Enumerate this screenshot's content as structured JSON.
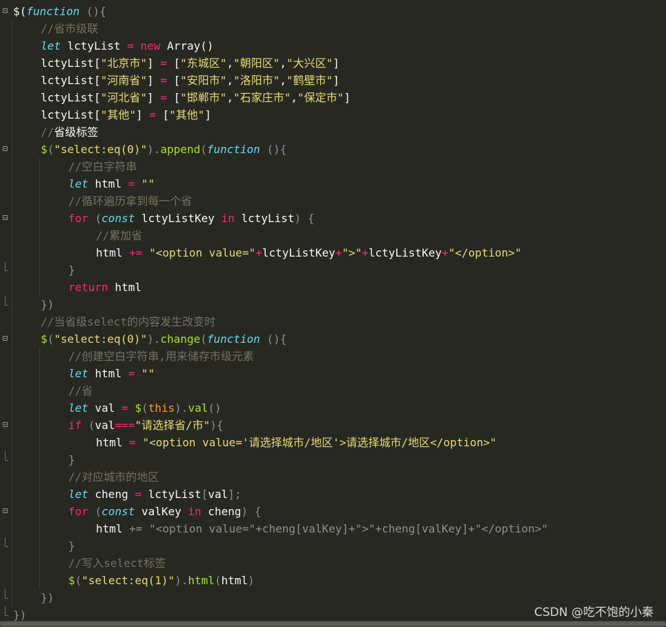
{
  "editor": {
    "lines": [
      {
        "indent": 0,
        "fold": "open",
        "tokens": [
          [
            "p",
            "$("
          ],
          [
            "i",
            "function"
          ],
          [
            "d",
            " (){"
          ]
        ]
      },
      {
        "indent": 1,
        "tokens": [
          [
            "c",
            "//省市级联"
          ]
        ]
      },
      {
        "indent": 1,
        "tokens": [
          [
            "i",
            "let"
          ],
          [
            "p",
            " lctyList "
          ],
          [
            "k",
            "="
          ],
          [
            "p",
            " "
          ],
          [
            "k",
            "new"
          ],
          [
            "p",
            " Array()"
          ]
        ]
      },
      {
        "indent": 1,
        "tokens": [
          [
            "p",
            "lctyList["
          ],
          [
            "s",
            "\"北京市\""
          ],
          [
            "p",
            "] "
          ],
          [
            "k",
            "="
          ],
          [
            "p",
            " ["
          ],
          [
            "s",
            "\"东城区\""
          ],
          [
            "p",
            ","
          ],
          [
            "s",
            "\"朝阳区\""
          ],
          [
            "p",
            ","
          ],
          [
            "s",
            "\"大兴区\""
          ],
          [
            "p",
            "]"
          ]
        ]
      },
      {
        "indent": 1,
        "tokens": [
          [
            "p",
            "lctyList["
          ],
          [
            "s",
            "\"河南省\""
          ],
          [
            "p",
            "] "
          ],
          [
            "k",
            "="
          ],
          [
            "p",
            " ["
          ],
          [
            "s",
            "\"安阳市\""
          ],
          [
            "p",
            ","
          ],
          [
            "s",
            "\"洛阳市\""
          ],
          [
            "p",
            ","
          ],
          [
            "s",
            "\"鹤壁市\""
          ],
          [
            "p",
            "]"
          ]
        ]
      },
      {
        "indent": 1,
        "tokens": [
          [
            "p",
            "lctyList["
          ],
          [
            "s",
            "\"河北省\""
          ],
          [
            "p",
            "] "
          ],
          [
            "k",
            "="
          ],
          [
            "p",
            " ["
          ],
          [
            "s",
            "\"邯郸市\""
          ],
          [
            "p",
            ","
          ],
          [
            "s",
            "\"石家庄市\""
          ],
          [
            "p",
            ","
          ],
          [
            "s",
            "\"保定市\""
          ],
          [
            "p",
            "]"
          ]
        ]
      },
      {
        "indent": 1,
        "tokens": [
          [
            "p",
            "lctyList["
          ],
          [
            "s",
            "\"其他\""
          ],
          [
            "p",
            "] "
          ],
          [
            "k",
            "="
          ],
          [
            "p",
            " ["
          ],
          [
            "s",
            "\"其他\""
          ],
          [
            "p",
            "]"
          ]
        ]
      },
      {
        "indent": 1,
        "tokens": [
          [
            "c",
            "//"
          ],
          [
            "p",
            "省级标签"
          ]
        ]
      },
      {
        "indent": 1,
        "fold": "open",
        "tokens": [
          [
            "f",
            "$"
          ],
          [
            "d",
            "("
          ],
          [
            "s",
            "\"select:eq(0)\""
          ],
          [
            "d",
            ")."
          ],
          [
            "f",
            "append"
          ],
          [
            "d",
            "("
          ],
          [
            "i",
            "function"
          ],
          [
            "d",
            " (){"
          ]
        ]
      },
      {
        "indent": 2,
        "tokens": [
          [
            "c",
            "//空白字符串"
          ]
        ]
      },
      {
        "indent": 2,
        "tokens": [
          [
            "i",
            "let"
          ],
          [
            "p",
            " html "
          ],
          [
            "k",
            "="
          ],
          [
            "p",
            " "
          ],
          [
            "s",
            "\"\""
          ]
        ]
      },
      {
        "indent": 2,
        "tokens": [
          [
            "c",
            "//循环遍历拿到每一个省"
          ]
        ]
      },
      {
        "indent": 2,
        "fold": "open",
        "tokens": [
          [
            "k",
            "for"
          ],
          [
            "d",
            " ("
          ],
          [
            "i",
            "const"
          ],
          [
            "p",
            " lctyListKey "
          ],
          [
            "k",
            "in"
          ],
          [
            "p",
            " lctyList"
          ],
          [
            "d",
            ") {"
          ]
        ]
      },
      {
        "indent": 3,
        "tokens": [
          [
            "c",
            "//累加省"
          ]
        ]
      },
      {
        "indent": 3,
        "tokens": [
          [
            "p",
            "html "
          ],
          [
            "k",
            "+="
          ],
          [
            "p",
            " "
          ],
          [
            "s",
            "\"<option value=\""
          ],
          [
            "k",
            "+"
          ],
          [
            "p",
            "lctyListKey"
          ],
          [
            "k",
            "+"
          ],
          [
            "s",
            "\">\""
          ],
          [
            "k",
            "+"
          ],
          [
            "p",
            "lctyListKey"
          ],
          [
            "k",
            "+"
          ],
          [
            "s",
            "\"</option>\""
          ]
        ]
      },
      {
        "indent": 2,
        "foldend": true,
        "tokens": [
          [
            "d",
            "}"
          ]
        ]
      },
      {
        "indent": 2,
        "tokens": [
          [
            "k",
            "return"
          ],
          [
            "p",
            " html"
          ]
        ]
      },
      {
        "indent": 1,
        "foldend": true,
        "tokens": [
          [
            "d",
            "})"
          ]
        ]
      },
      {
        "indent": 1,
        "tokens": [
          [
            "c",
            "//当省级select的内容发生改变时"
          ]
        ]
      },
      {
        "indent": 1,
        "fold": "open",
        "tokens": [
          [
            "f",
            "$"
          ],
          [
            "d",
            "("
          ],
          [
            "s",
            "\"select:eq(0)\""
          ],
          [
            "d",
            ")."
          ],
          [
            "f",
            "change"
          ],
          [
            "d",
            "("
          ],
          [
            "i",
            "function"
          ],
          [
            "d",
            " (){"
          ]
        ]
      },
      {
        "indent": 2,
        "tokens": [
          [
            "c",
            "//创建空白字符串,用来储存市级元素"
          ]
        ]
      },
      {
        "indent": 2,
        "tokens": [
          [
            "i",
            "let"
          ],
          [
            "p",
            " html "
          ],
          [
            "k",
            "="
          ],
          [
            "p",
            " "
          ],
          [
            "s",
            "\"\""
          ]
        ]
      },
      {
        "indent": 2,
        "tokens": [
          [
            "c",
            "//省"
          ]
        ]
      },
      {
        "indent": 2,
        "tokens": [
          [
            "i",
            "let"
          ],
          [
            "p",
            " val "
          ],
          [
            "k",
            "="
          ],
          [
            "p",
            " "
          ],
          [
            "f",
            "$"
          ],
          [
            "d",
            "("
          ],
          [
            "o",
            "this"
          ],
          [
            "d",
            ")."
          ],
          [
            "f",
            "val"
          ],
          [
            "d",
            "()"
          ]
        ]
      },
      {
        "indent": 2,
        "fold": "open",
        "tokens": [
          [
            "k",
            "if"
          ],
          [
            "d",
            " ("
          ],
          [
            "p",
            "val"
          ],
          [
            "k",
            "==="
          ],
          [
            "s",
            "\"请选择省/市\""
          ],
          [
            "d",
            "){"
          ]
        ]
      },
      {
        "indent": 3,
        "tokens": [
          [
            "p",
            "html "
          ],
          [
            "k",
            "="
          ],
          [
            "p",
            " "
          ],
          [
            "s",
            "\"<option value='请选择城市/地区'>请选择城市/地区</option>\""
          ]
        ]
      },
      {
        "indent": 2,
        "foldend": true,
        "tokens": [
          [
            "d",
            "}"
          ]
        ]
      },
      {
        "indent": 2,
        "tokens": [
          [
            "c",
            "//对应城市的地区"
          ]
        ]
      },
      {
        "indent": 2,
        "tokens": [
          [
            "i",
            "let"
          ],
          [
            "p",
            " cheng "
          ],
          [
            "k",
            "="
          ],
          [
            "p",
            " lctyList"
          ],
          [
            "d",
            "["
          ],
          [
            "p",
            "val"
          ],
          [
            "d",
            "];"
          ]
        ]
      },
      {
        "indent": 2,
        "fold": "open",
        "tokens": [
          [
            "k",
            "for"
          ],
          [
            "d",
            " ("
          ],
          [
            "i",
            "const"
          ],
          [
            "p",
            " valKey "
          ],
          [
            "k",
            "in"
          ],
          [
            "p",
            " cheng"
          ],
          [
            "d",
            ") {"
          ]
        ]
      },
      {
        "indent": 3,
        "tokens": [
          [
            "p",
            "html "
          ],
          [
            "cd",
            "+= \"<option value=\"+cheng[valKey]+\">\"+cheng[valKey]+\"</option>\""
          ]
        ]
      },
      {
        "indent": 2,
        "foldend": true,
        "tokens": [
          [
            "d",
            "}"
          ]
        ]
      },
      {
        "indent": 2,
        "tokens": [
          [
            "c",
            "//写入select标签"
          ]
        ]
      },
      {
        "indent": 2,
        "tokens": [
          [
            "f",
            "$"
          ],
          [
            "d",
            "("
          ],
          [
            "s",
            "\"select:eq(1)\""
          ],
          [
            "d",
            ")."
          ],
          [
            "f",
            "html"
          ],
          [
            "d",
            "("
          ],
          [
            "p",
            "html"
          ],
          [
            "d",
            ")"
          ]
        ]
      },
      {
        "indent": 1,
        "foldend": true,
        "tokens": [
          [
            "d",
            "})"
          ]
        ]
      },
      {
        "indent": 0,
        "foldend": true,
        "tokens": [
          [
            "d",
            "})"
          ]
        ]
      }
    ]
  },
  "watermark": "CSDN @吃不饱的小秦",
  "colors": {
    "background": "#272822",
    "keyword": "#f92672",
    "string": "#e6db74",
    "comment": "#75715e",
    "storage": "#66d9ef",
    "function": "#a6e22e",
    "this": "#fd971f"
  }
}
